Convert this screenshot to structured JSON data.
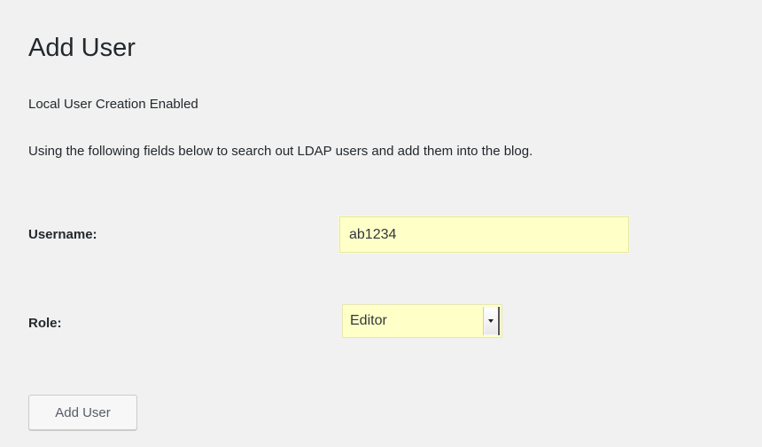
{
  "page": {
    "title": "Add User",
    "notice": "Local User Creation Enabled",
    "intro": "Using the following fields below to search out LDAP users and add them into the blog."
  },
  "form": {
    "username_label": "Username:",
    "username_value": "ab1234",
    "role_label": "Role:",
    "role_selected": "Editor",
    "submit_label": "Add User"
  },
  "colors": {
    "page_background": "#f1f1f1",
    "autofill_highlight": "#ffffc8",
    "text": "#23282d"
  }
}
